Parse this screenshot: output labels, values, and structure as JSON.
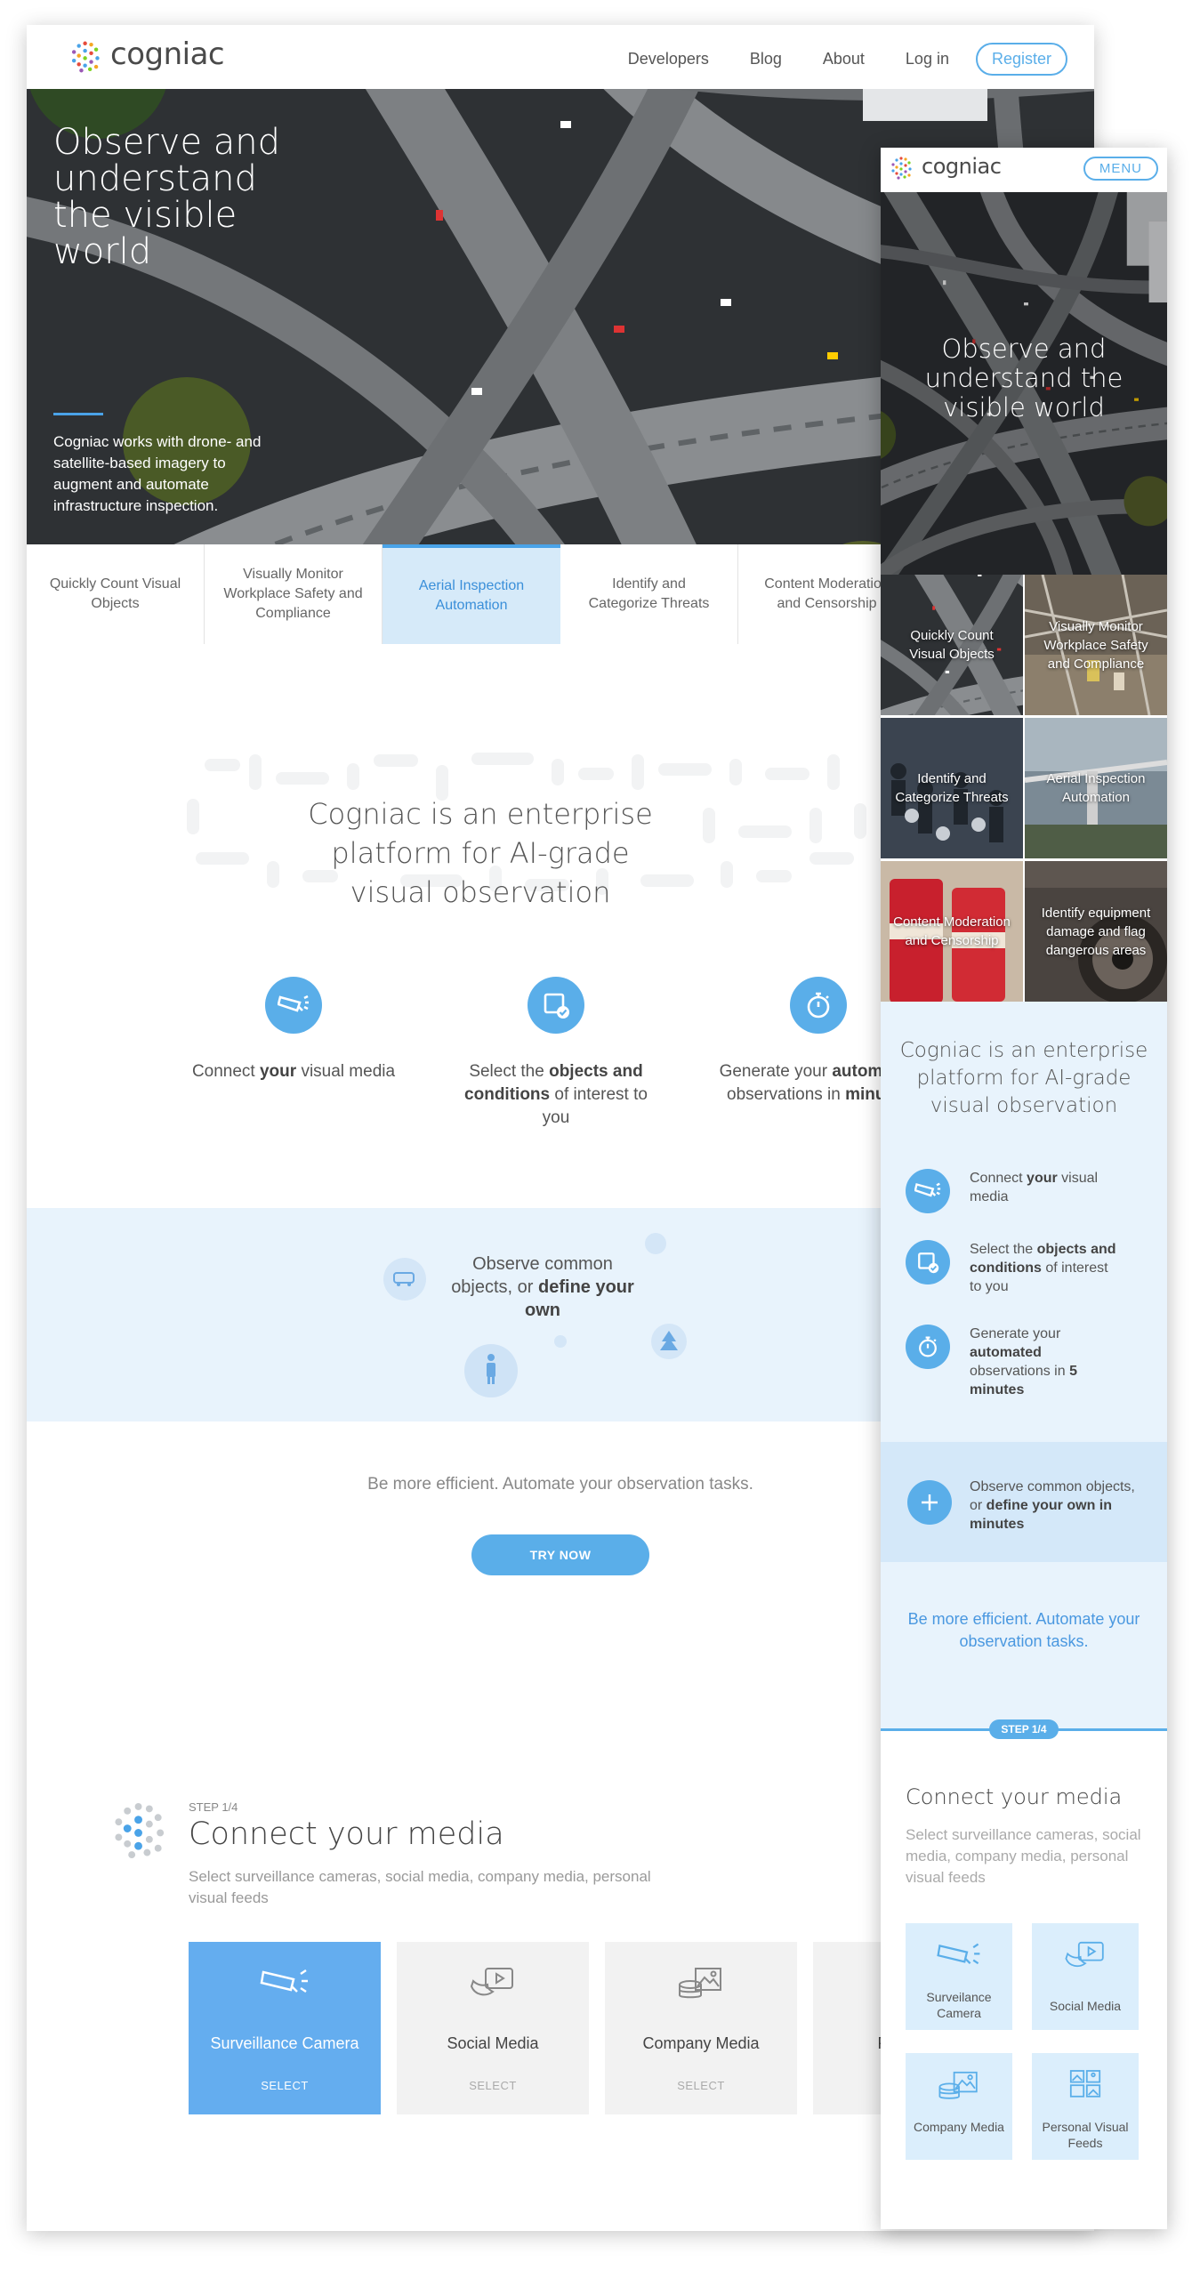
{
  "brand": {
    "name": "cogniac"
  },
  "colors": {
    "accent": "#5aaee9",
    "accent_dark": "#3a8fd9",
    "pale_blue": "#e8f3fc"
  },
  "desktop": {
    "nav": {
      "links": [
        "Developers",
        "Blog",
        "About",
        "Log in"
      ],
      "register": "Register"
    },
    "hero": {
      "title": "Observe and understand the visible world",
      "description": "Cogniac works with drone- and satellite-based imagery to augment and automate infrastructure inspection."
    },
    "tabs": [
      {
        "label": "Quickly Count Visual Objects",
        "active": false
      },
      {
        "label": "Visually Monitor Workplace Safety and Compliance",
        "active": false
      },
      {
        "label": "Aerial Inspection Automation",
        "active": true
      },
      {
        "label": "Identify and Categorize Threats",
        "active": false
      },
      {
        "label": "Content Moderation and Censorship",
        "active": false
      }
    ],
    "platform_heading": "Cogniac is an enterprise platform for AI-grade visual observation",
    "steps": [
      {
        "icon": "camera-icon",
        "pre": "Connect ",
        "bold": "your",
        "post": " visual media"
      },
      {
        "icon": "select-check-icon",
        "pre": "Select the ",
        "bold": "objects and conditions",
        "post": " of interest to you"
      },
      {
        "icon": "stopwatch-icon",
        "pre": "Generate your ",
        "bold": "automated",
        "mid": " observations in ",
        "bold2": "minutes"
      }
    ],
    "observe": {
      "pre": "Observe common objects, or ",
      "bold": "define your own"
    },
    "efficiency": "Be more efficient. Automate your observation tasks.",
    "try_now": "TRY NOW",
    "connect": {
      "step": "STEP 1/4",
      "heading": "Connect your media",
      "subtitle": "Select surveillance cameras, social media, company media, personal visual feeds",
      "cards": [
        {
          "name": "Surveillance Camera",
          "action": "SELECT",
          "selected": true,
          "icon": "surveillance-camera-icon"
        },
        {
          "name": "Social Media",
          "action": "SELECT",
          "selected": false,
          "icon": "social-media-icon"
        },
        {
          "name": "Company Media",
          "action": "SELECT",
          "selected": false,
          "icon": "company-media-icon"
        },
        {
          "name": "Personal",
          "action": "",
          "selected": false,
          "icon": "personal-feeds-icon"
        }
      ]
    }
  },
  "mobile": {
    "menu": "MENU",
    "hero_title": "Observe and understand the visible world",
    "tiles": [
      "Quickly Count Visual Objects",
      "Visually Monitor Workplace Safety and Compliance",
      "Identify and Categorize Threats",
      "Aerial Inspection Automation",
      "Content Moderation and Censorship",
      "Identify equipment damage and flag dangerous areas"
    ],
    "platform_heading": "Cogniac is an enterprise platform for AI-grade visual observation",
    "steps": [
      {
        "pre": "Connect ",
        "bold": "your",
        "post": " visual media"
      },
      {
        "pre": "Select the ",
        "bold": "objects and conditions",
        "post": " of interest to you"
      },
      {
        "pre": "Generate your ",
        "bold": "automated",
        "mid": " observations in ",
        "bold2": "5 minutes"
      }
    ],
    "observe": {
      "pre": "Observe common objects, or ",
      "bold": "define your own in minutes"
    },
    "efficiency": "Be more efficient. Automate your observation tasks.",
    "step_badge": "STEP 1/4",
    "connect": {
      "heading": "Connect your media",
      "subtitle": "Select surveillance cameras, social media, company media, personal visual feeds",
      "cards": [
        "Surveilance Camera",
        "Social Media",
        "Company Media",
        "Personal Visual Feeds"
      ]
    }
  }
}
